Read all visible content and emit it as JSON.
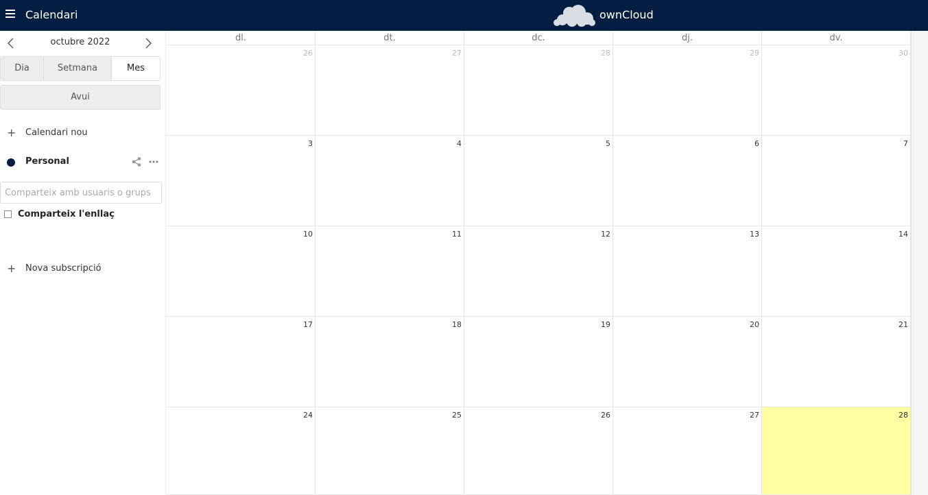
{
  "header": {
    "app_name": "Calendari",
    "brand": "ownCloud",
    "color": "#041e42"
  },
  "sidebar": {
    "month_label": "octubre 2022",
    "views": [
      "Dia",
      "Setmana",
      "Mes"
    ],
    "active_view": "Mes",
    "today_label": "Avui",
    "new_calendar_label": "Calendari nou",
    "calendar": {
      "name": "Personal",
      "color": "#041e42"
    },
    "share_placeholder": "Comparteix amb usuaris o grups",
    "share_link_label": "Comparteix l'enllaç",
    "share_link_checked": false,
    "new_subscription_label": "Nova subscripció"
  },
  "calendar": {
    "weekdays": [
      "dl.",
      "dt.",
      "dc.",
      "dj.",
      "dv."
    ],
    "weeks": [
      [
        {
          "d": "26",
          "other": true
        },
        {
          "d": "27",
          "other": true
        },
        {
          "d": "28",
          "other": true
        },
        {
          "d": "29",
          "other": true
        },
        {
          "d": "30",
          "other": true
        }
      ],
      [
        {
          "d": "3"
        },
        {
          "d": "4"
        },
        {
          "d": "5"
        },
        {
          "d": "6"
        },
        {
          "d": "7"
        }
      ],
      [
        {
          "d": "10"
        },
        {
          "d": "11"
        },
        {
          "d": "12"
        },
        {
          "d": "13"
        },
        {
          "d": "14"
        }
      ],
      [
        {
          "d": "17"
        },
        {
          "d": "18"
        },
        {
          "d": "19"
        },
        {
          "d": "20"
        },
        {
          "d": "21"
        }
      ],
      [
        {
          "d": "24"
        },
        {
          "d": "25"
        },
        {
          "d": "26"
        },
        {
          "d": "27"
        },
        {
          "d": "28",
          "today": true
        }
      ]
    ],
    "today_color": "#ffffa3"
  }
}
